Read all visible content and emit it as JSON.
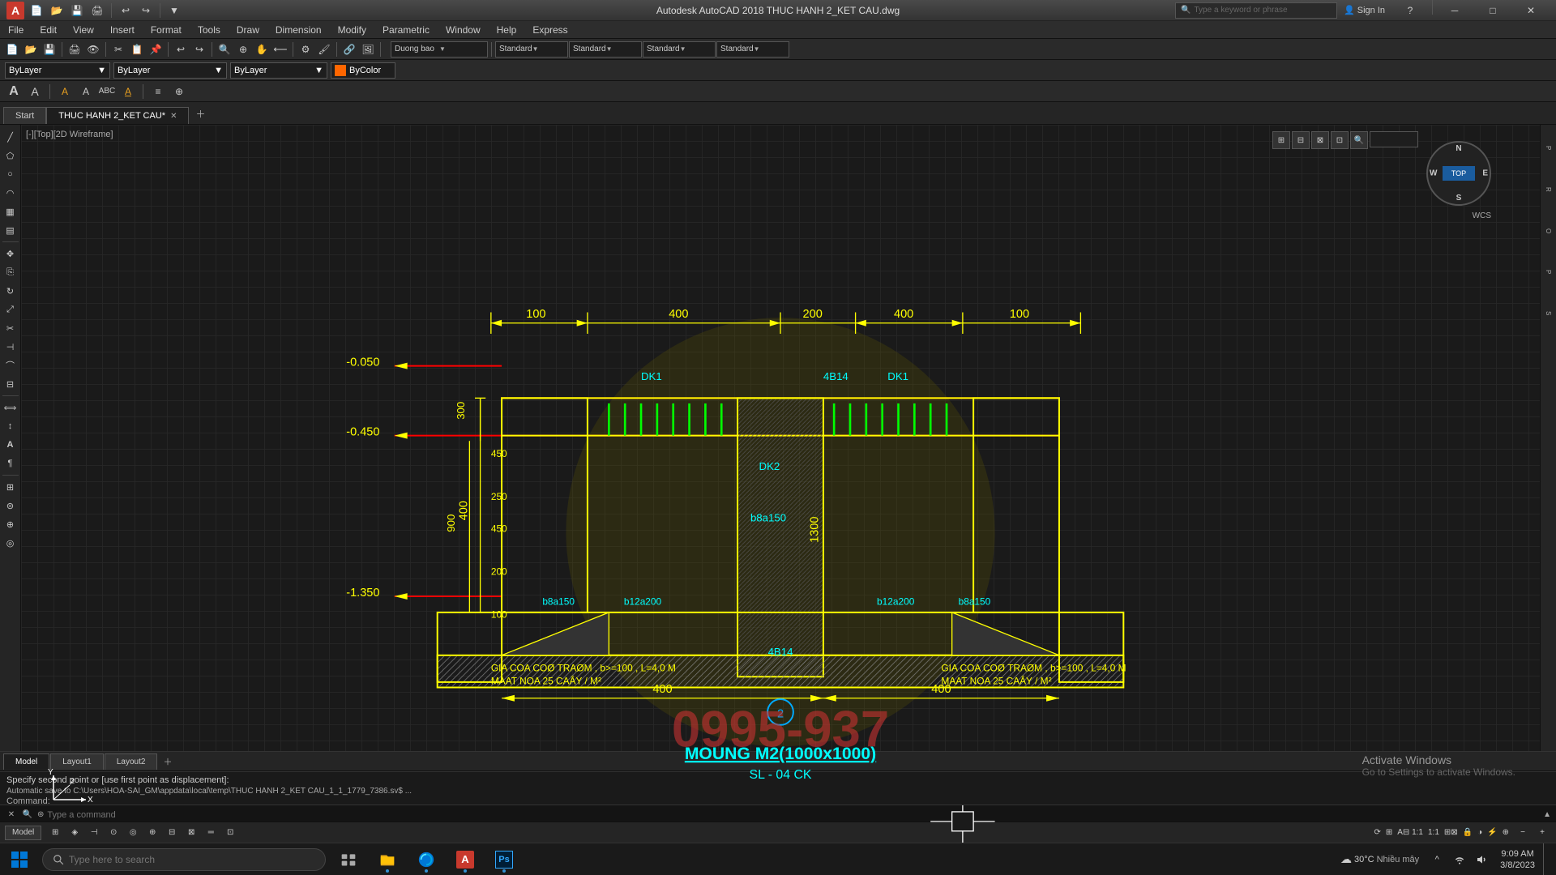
{
  "app": {
    "title": "Autodesk AutoCAD 2018  THUC HANH 2_KET CAU.dwg",
    "icon": "A",
    "file_name": "THUC HANH 2_KET CAU.dwg"
  },
  "title_bar": {
    "search_placeholder": "Type a keyword or phrase",
    "sign_in": "Sign In",
    "minimize": "─",
    "maximize": "□",
    "close": "✕",
    "quick_access": [
      "save",
      "undo",
      "redo",
      "open",
      "new"
    ]
  },
  "menu_bar": {
    "items": [
      "File",
      "Edit",
      "View",
      "Insert",
      "Format",
      "Tools",
      "Draw",
      "Dimension",
      "Modify",
      "Parametric",
      "Window",
      "Help",
      "Express"
    ]
  },
  "tabs": {
    "active": "THUC HANH 2_KET CAU*",
    "items": [
      "Start",
      "THUC HANH 2_KET CAU*"
    ]
  },
  "layer": {
    "current": "ByLayer",
    "linetype": "ByLayer",
    "lineweight": "ByLayer",
    "color": "ByColor"
  },
  "viewport": {
    "label": "[-][Top][2D Wireframe]"
  },
  "compass": {
    "n": "N",
    "s": "S",
    "e": "E",
    "w": "W",
    "center": "TOP",
    "wcs": "WCS"
  },
  "drawing": {
    "annotation1": "MOUNG M2(1000x1000)",
    "annotation2": "SL - 04 CK",
    "watermark": "0995-937",
    "dim_100_left": "100",
    "dim_400_left": "400",
    "dim_200_center": "200",
    "dim_400_right": "400",
    "dim_100_right": "100",
    "elevation_050": "-0.050",
    "elevation_450": "-0.450",
    "elevation_350": "-1.350",
    "dk1_left": "DK1",
    "dk1_right": "DK1",
    "dk2": "DK2",
    "bars1": "4B14",
    "b8a150_left": "b8a150",
    "b12a200_left": "b12a200",
    "b12a200_right": "b12a200",
    "b8a150_right": "b8a150",
    "b8a150_center": "b8a150",
    "dim_400_bot1": "400",
    "dim_400_bot2": "400",
    "note_left1": "GIA COA COØ TRAØM , b>=100 , L=4,0 M",
    "note_left2": "MAAT NOA 25 CAÂY / M²",
    "note_right1": "GIA COA COØ TRAØM , b>=100 , L=4,0 M",
    "note_right2": "MAAT NOA 25 CAÂY / M²",
    "bars2": "4B14",
    "circle_num": "2"
  },
  "command_output": {
    "line1": "Specify second point or [use first point as displacement]:",
    "line2": "Automatic save to C:\\Users\\HOA-SAI_GM\\appdata\\local\\temp\\THUC HANH 2_KET CAU_1_1_1779_7386.sv$  ..."
  },
  "command_input": {
    "placeholder": "Type a command",
    "current": ""
  },
  "layout_tabs": {
    "items": [
      "Model",
      "Layout1",
      "Layout2"
    ],
    "active": "Model"
  },
  "status_bar": {
    "model_label": "MODEL",
    "icons": [
      "grid",
      "snap",
      "ortho",
      "polar",
      "osnap",
      "otrack",
      "ducs",
      "dyn",
      "lw",
      "tp"
    ],
    "zoom_level": "1:1",
    "annotation_scale": "1:1",
    "right_items": [
      "lock",
      "isolate",
      "sync",
      "hardware",
      "clean"
    ]
  },
  "toolbar_standard": {
    "layer_label": "Duong bao",
    "standards": [
      "Standard",
      "Standard",
      "Standard",
      "Standard"
    ]
  },
  "taskbar": {
    "search_placeholder": "Type here to search",
    "start_icon": "⊞",
    "apps": [
      "file-explorer",
      "edge",
      "folder",
      "store",
      "autocad",
      "photoshop"
    ],
    "time": "9:09 AM",
    "date": "3/8/2023",
    "tray": [
      "network",
      "volume",
      "battery"
    ],
    "temperature": "30°C",
    "weather": "Nhiều mây"
  },
  "activate_windows": {
    "title": "Activate Windows",
    "subtitle": "Go to Settings to activate Windows."
  }
}
